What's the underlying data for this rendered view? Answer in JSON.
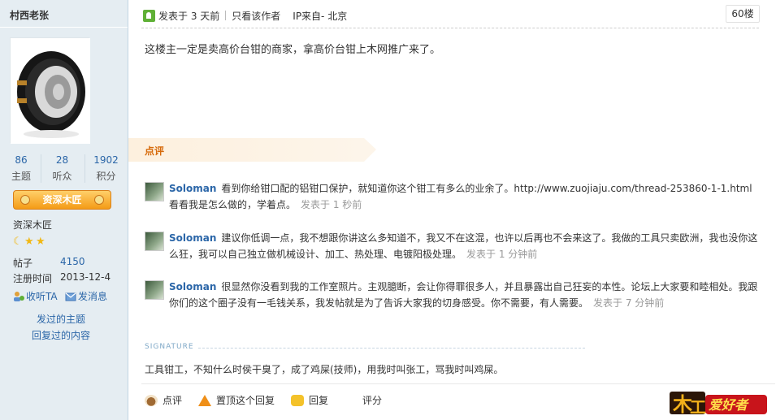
{
  "sidebar": {
    "author": "村西老张",
    "stats": [
      {
        "value": "86",
        "label": "主题"
      },
      {
        "value": "28",
        "label": "听众"
      },
      {
        "value": "1902",
        "label": "积分"
      }
    ],
    "rank_badge": "资深木匠",
    "rank_title": "资深木匠",
    "stars": 3,
    "posts_label": "帖子",
    "posts_value": "4150",
    "reg_label": "注册时间",
    "reg_value": "2013-12-4",
    "follow_label": "收听TA",
    "message_label": "发消息",
    "topics_link": "发过的主题",
    "replies_link": "回复过的内容"
  },
  "post": {
    "posted": "发表于 3 天前",
    "author_only": "只看该作者",
    "ip": "IP来自- 北京",
    "floor": "60楼",
    "body": "这楼主一定是卖高价台钳的商家，拿高价台钳上木网推广来了。"
  },
  "comments_header": "点评",
  "comments": [
    {
      "user": "Soloman",
      "text": "看到你给钳口配的铝钳口保护，就知道你这个钳工有多么的业余了。http://www.zuojiaju.com/thread-253860-1-1.html看看我是怎么做的，学着点。",
      "time": "发表于 1 秒前"
    },
    {
      "user": "Soloman",
      "text": "建议你低调一点，我不想跟你讲这么多知道不，我又不在这混，也许以后再也不会来这了。我做的工具只卖欧洲，我也没你这么狂，我可以自己独立做机械设计、加工、热处理、电镀阳极处理。",
      "time": "发表于 1 分钟前"
    },
    {
      "user": "Soloman",
      "text": "很显然你没看到我的工作室照片。主观臆断，会让你得罪很多人，并且暴露出自己狂妄的本性。论坛上大家要和睦相处。我跟你们的这个圈子没有一毛钱关系，我发帖就是为了告诉大家我的切身感受。你不需要，有人需要。",
      "time": "发表于 7 分钟前"
    }
  ],
  "signature": {
    "label": "SIGNATURE",
    "text": "工具钳工，不知什么时侯干臭了，成了鸡屎(技师)，用我时叫张工，骂我时叫鸡屎。"
  },
  "footer": {
    "comment": "点评",
    "top_reply": "置顶这个回复",
    "reply": "回复",
    "rate": "评分"
  },
  "logo_text": "木工爱好者",
  "colors": {
    "accent": "#2b66a8",
    "orange": "#ef8f18",
    "sidebar_bg": "#e5edf2"
  }
}
